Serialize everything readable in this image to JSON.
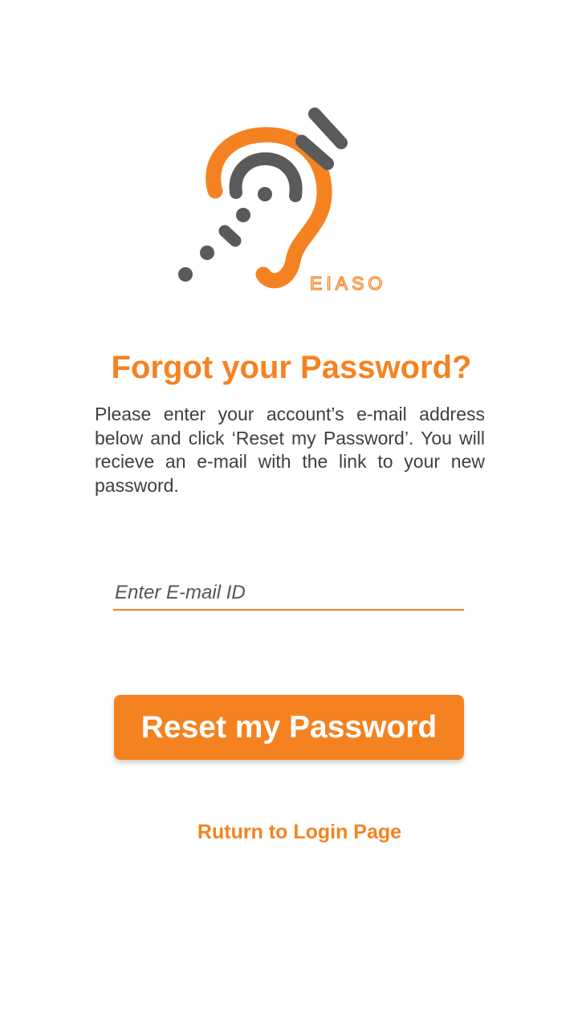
{
  "logo": {
    "wordmark": "EIASO",
    "icon": "hearing-ear-icon",
    "colors": {
      "orange": "#f58220",
      "gray": "#5a5a5a"
    }
  },
  "page": {
    "title": "Forgot your Password?",
    "description": "Please enter your account’s e-mail address below and click ‘Reset my Password’. You will recieve an e-mail with the link to your new password."
  },
  "form": {
    "email_placeholder": "Enter E-mail ID",
    "email_value": "",
    "reset_label": "Reset my Password"
  },
  "footer": {
    "return_label": "Ruturn to Login Page"
  },
  "colors": {
    "accent": "#f58220",
    "text": "#3f3f3f",
    "background": "#ffffff"
  }
}
